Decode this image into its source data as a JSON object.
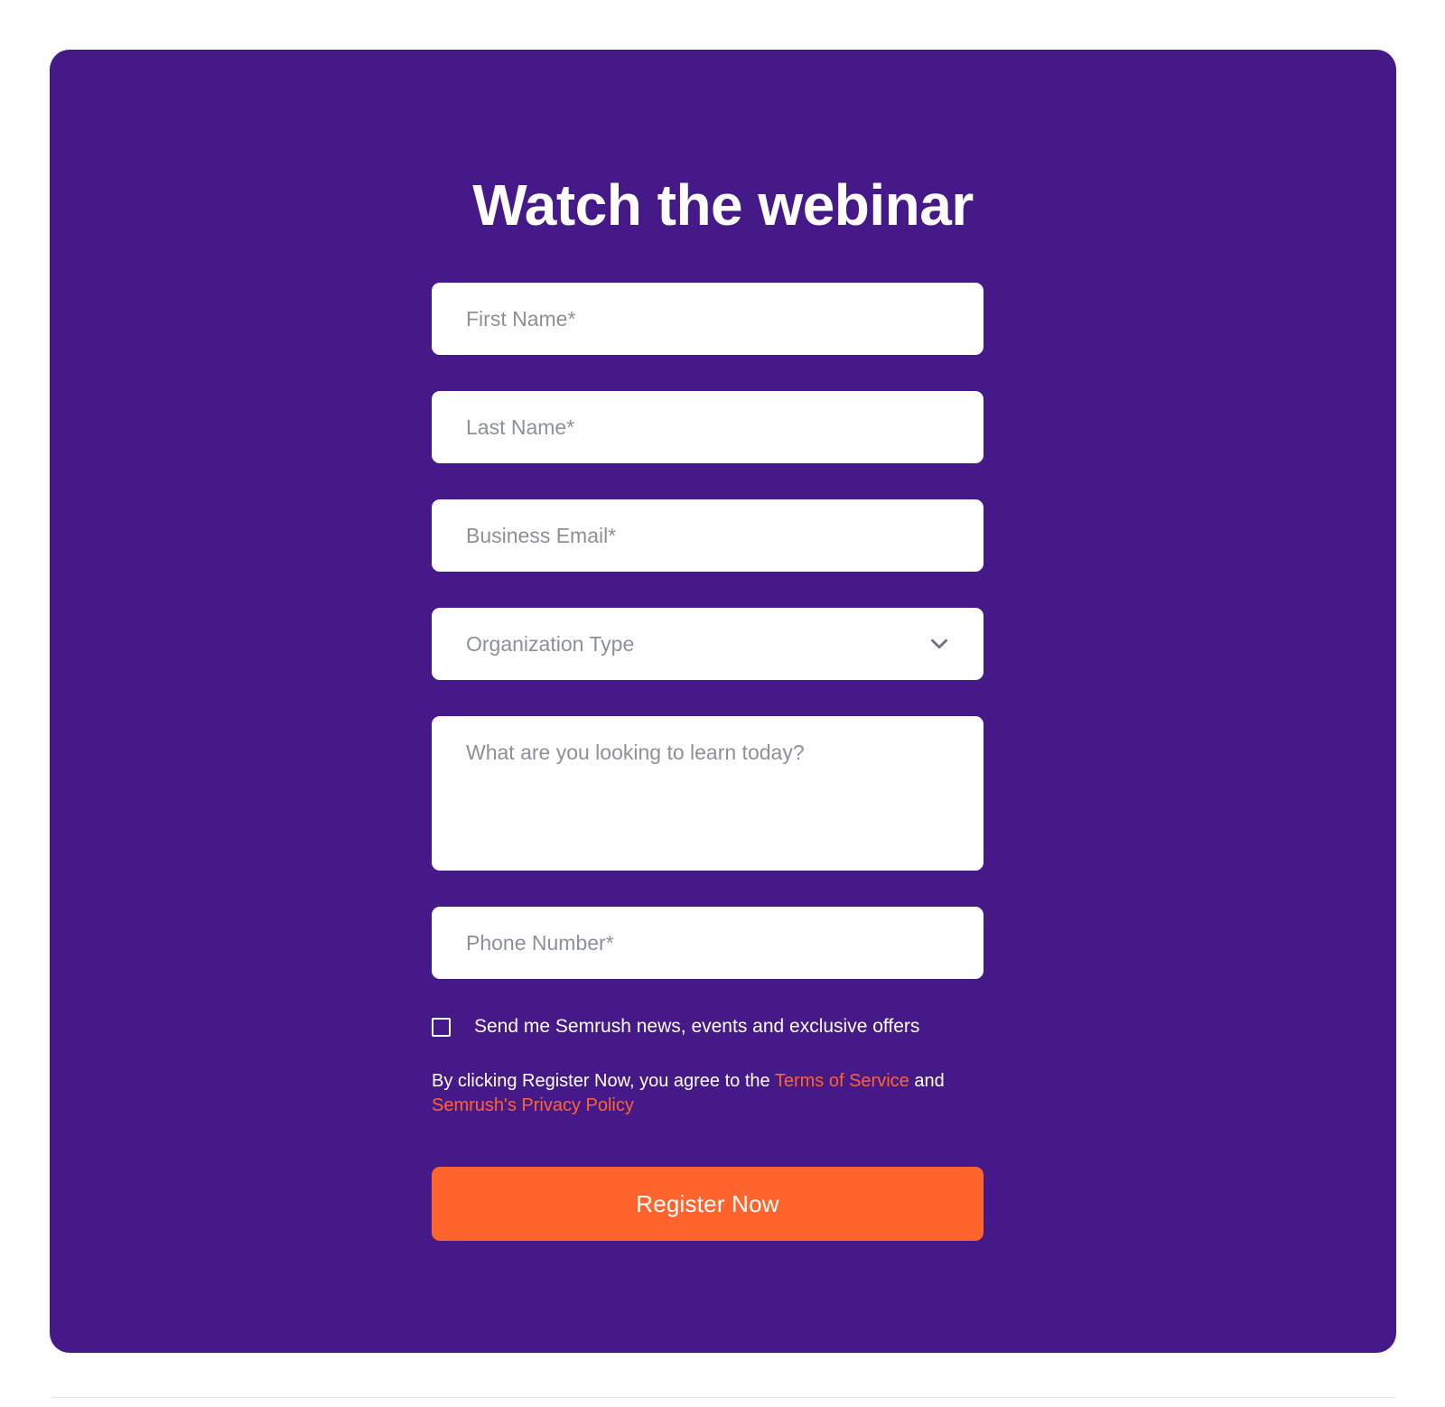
{
  "card": {
    "title": "Watch the webinar",
    "background_color": "#451987"
  },
  "form": {
    "fields": [
      {
        "name": "first-name",
        "placeholder": "First Name*",
        "value": "",
        "type": "text"
      },
      {
        "name": "last-name",
        "placeholder": "Last Name*",
        "value": "",
        "type": "text"
      },
      {
        "name": "business-email",
        "placeholder": "Business Email*",
        "value": "",
        "type": "email"
      }
    ],
    "organization_type": {
      "placeholder": "Organization Type",
      "selected": "Organization Type",
      "icon": "chevron-down-icon"
    },
    "message": {
      "placeholder": "What are you looking to learn today?",
      "value": ""
    },
    "phone": {
      "placeholder": "Phone Number*",
      "value": ""
    },
    "newsletter_checkbox": {
      "label": "Send me Semrush news, events and exclusive offers",
      "checked": false
    },
    "legal": {
      "prefix": "By clicking Register Now, you agree to the ",
      "terms_link": "Terms of Service",
      "conjunction": " and ",
      "privacy_link": "Semrush's Privacy Policy"
    },
    "submit_label": "Register Now",
    "accent_color": "#ff642d",
    "link_color": "#ff642d"
  }
}
